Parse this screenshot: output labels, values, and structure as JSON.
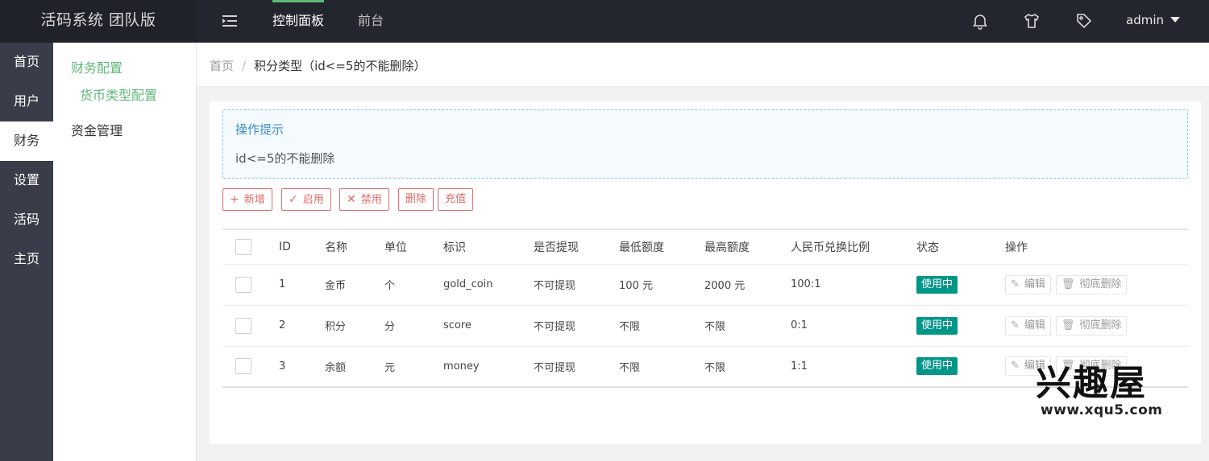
{
  "app": {
    "title": "活码系统 团队版"
  },
  "topnav": {
    "items": [
      "控制面板",
      "前台"
    ]
  },
  "user": {
    "name": "admin"
  },
  "sidebar": {
    "items": [
      "首页",
      "用户",
      "财务",
      "设置",
      "活码",
      "主页"
    ],
    "active": "财务"
  },
  "subsidebar": {
    "group1": "财务配置",
    "group1_child": "货币类型配置",
    "group2": "资金管理"
  },
  "breadcrumb": {
    "home": "首页",
    "separator": "/",
    "current": "积分类型（id<=5的不能删除）"
  },
  "tip": {
    "title": "操作提示",
    "text": "id<=5的不能删除"
  },
  "toolbar": {
    "add": "新增",
    "enable": "启用",
    "disable": "禁用",
    "delete": "删除",
    "recharge": "充值"
  },
  "table": {
    "headers": [
      "ID",
      "名称",
      "单位",
      "标识",
      "是否提现",
      "最低额度",
      "最高额度",
      "人民币兑换比例",
      "状态",
      "操作"
    ],
    "rows": [
      {
        "id": "1",
        "name": "金币",
        "unit": "个",
        "key": "gold_coin",
        "withdraw": "不可提现",
        "min": "100 元",
        "max": "2000 元",
        "ratio": "100:1",
        "status": "使用中"
      },
      {
        "id": "2",
        "name": "积分",
        "unit": "分",
        "key": "score",
        "withdraw": "不可提现",
        "min": "不限",
        "max": "不限",
        "ratio": "0:1",
        "status": "使用中"
      },
      {
        "id": "3",
        "name": "余额",
        "unit": "元",
        "key": "money",
        "withdraw": "不可提现",
        "min": "不限",
        "max": "不限",
        "ratio": "1:1",
        "status": "使用中"
      }
    ],
    "actions": {
      "edit": "编辑",
      "purge": "彻底删除"
    }
  },
  "watermark": {
    "big": "兴趣屋",
    "small": "www.xqu5.com"
  },
  "colors": {
    "accent": "#5fb878",
    "badge": "#009688",
    "danger": "#e06b6b",
    "topbar": "#23262e",
    "sidebar": "#393d49"
  }
}
